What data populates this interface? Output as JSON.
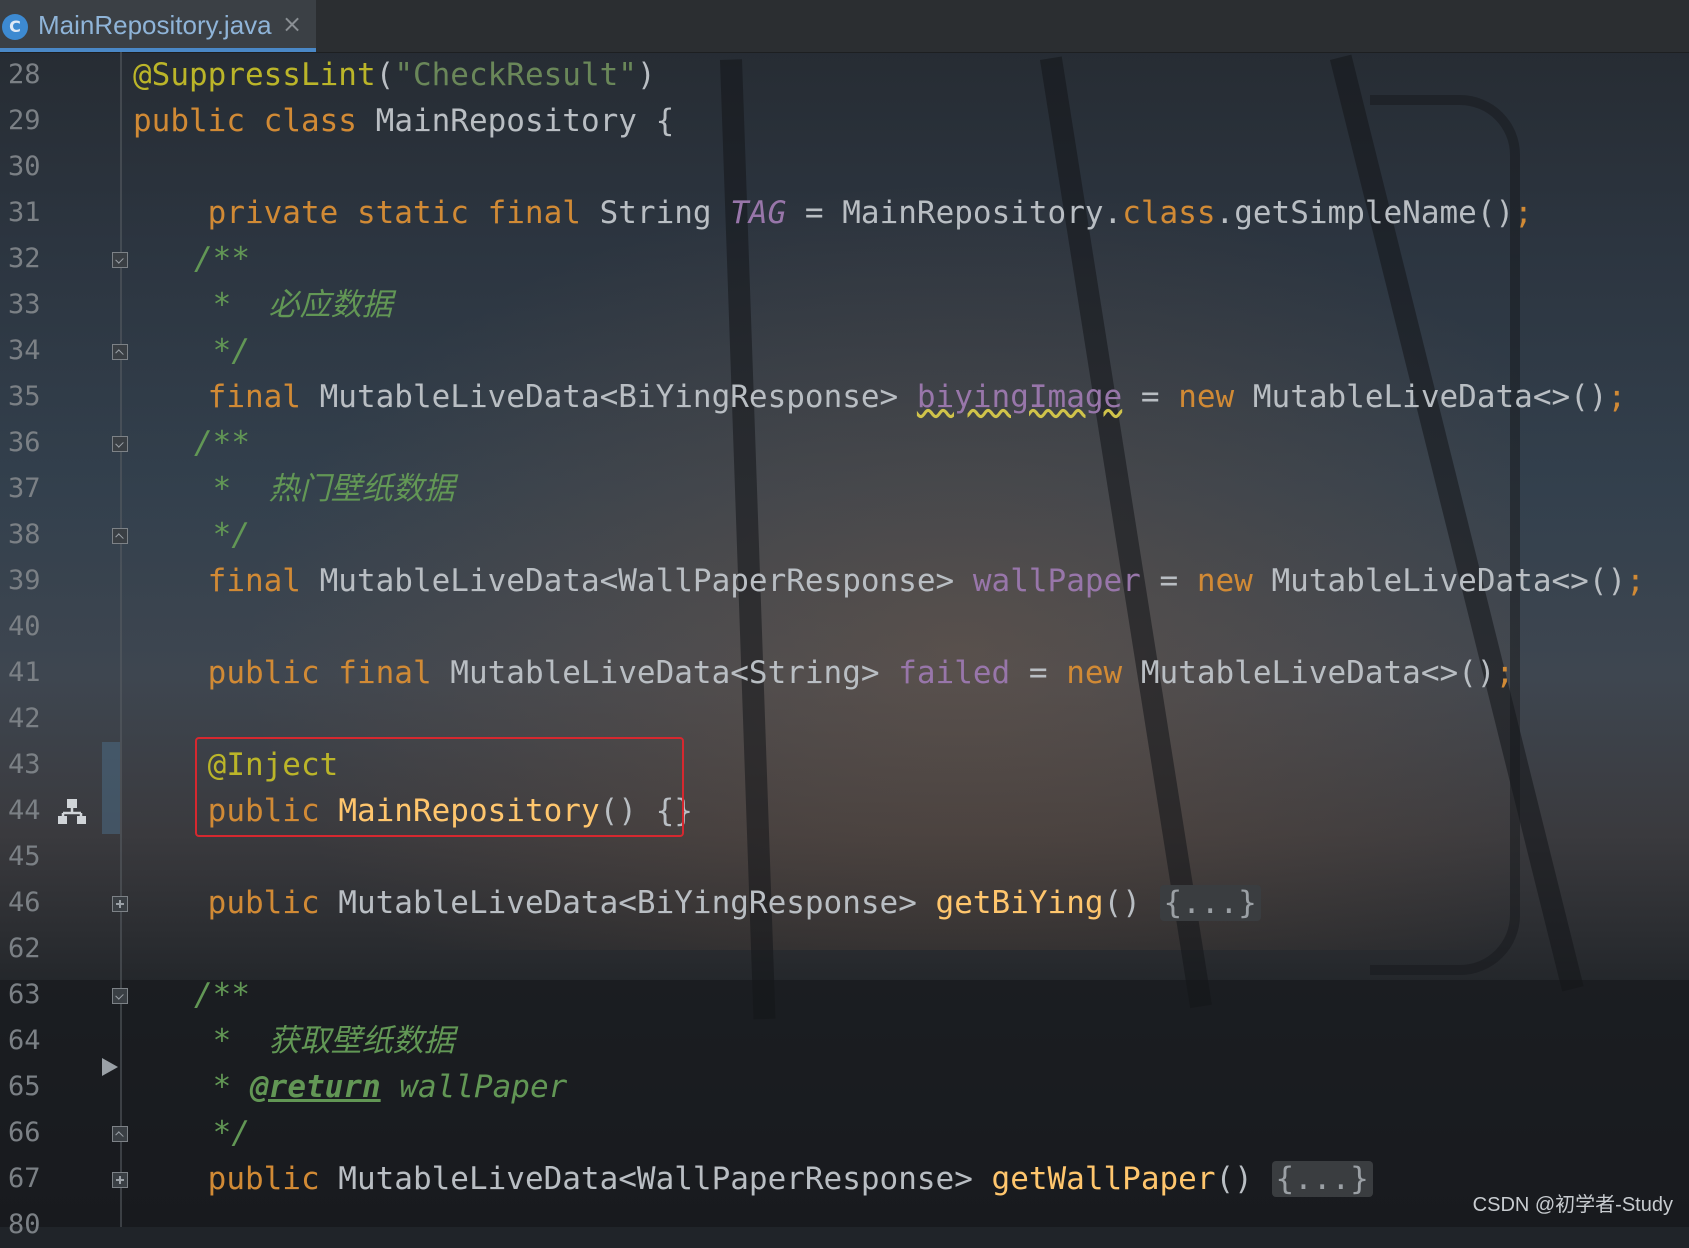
{
  "tab": {
    "icon_letter": "C",
    "title": "MainRepository.java",
    "close": "×"
  },
  "line_numbers": [
    "28",
    "29",
    "30",
    "31",
    "32",
    "33",
    "34",
    "35",
    "36",
    "37",
    "38",
    "39",
    "40",
    "41",
    "42",
    "43",
    "44",
    "45",
    "46",
    "62",
    "63",
    "64",
    "65",
    "66",
    "67",
    "80"
  ],
  "code": {
    "l28": {
      "ann": "@SuppressLint",
      "p1": "(",
      "str": "\"CheckResult\"",
      "p2": ")"
    },
    "l29": {
      "kw1": "public",
      "kw2": "class",
      "name": "MainRepository {"
    },
    "l31": {
      "kw": "private static final",
      "type": "String",
      "const": "TAG",
      "eq": " = MainRepository.",
      "cls": "class",
      "rest": ".getSimpleName()",
      "semi": ";"
    },
    "l32": {
      "text": "/**"
    },
    "l33": {
      "text": " *  必应数据"
    },
    "l34": {
      "text": " */"
    },
    "l35": {
      "kw": "final",
      "type": " MutableLiveData<BiYingResponse> ",
      "field": "biyingImage",
      "eq": " = ",
      "kw2": "new",
      "rest": " MutableLiveData<>()",
      "semi": ";"
    },
    "l36": {
      "text": "/**"
    },
    "l37": {
      "text": " *  热门壁纸数据"
    },
    "l38": {
      "text": " */"
    },
    "l39": {
      "kw": "final",
      "type": " MutableLiveData<WallPaperResponse> ",
      "field": "wallPaper",
      "eq": " = ",
      "kw2": "new",
      "rest": " MutableLiveData<>()",
      "semi": ";"
    },
    "l41": {
      "kw": "public final",
      "type": " MutableLiveData<String> ",
      "field": "failed",
      "eq": " = ",
      "kw2": "new",
      "rest": " MutableLiveData<>()",
      "semi": ";"
    },
    "l43": {
      "ann": "@Inject"
    },
    "l44": {
      "kw": "public",
      "name": "MainRepository",
      "rest": "() {}"
    },
    "l46": {
      "kw": "public",
      "type": " MutableLiveData<BiYingResponse> ",
      "method": "getBiYing",
      "paren": "() ",
      "folded": "{...}"
    },
    "l63": {
      "text": "/**"
    },
    "l64": {
      "text": " *  获取壁纸数据"
    },
    "l65": {
      "star": " * ",
      "tag": "@return",
      "desc": " wallPaper"
    },
    "l66": {
      "text": " */"
    },
    "l67": {
      "kw": "public",
      "type": " MutableLiveData<WallPaperResponse> ",
      "method": "getWallPaper",
      "paren": "() ",
      "folded": "{...}"
    }
  },
  "watermark": "CSDN @初学者-Study"
}
